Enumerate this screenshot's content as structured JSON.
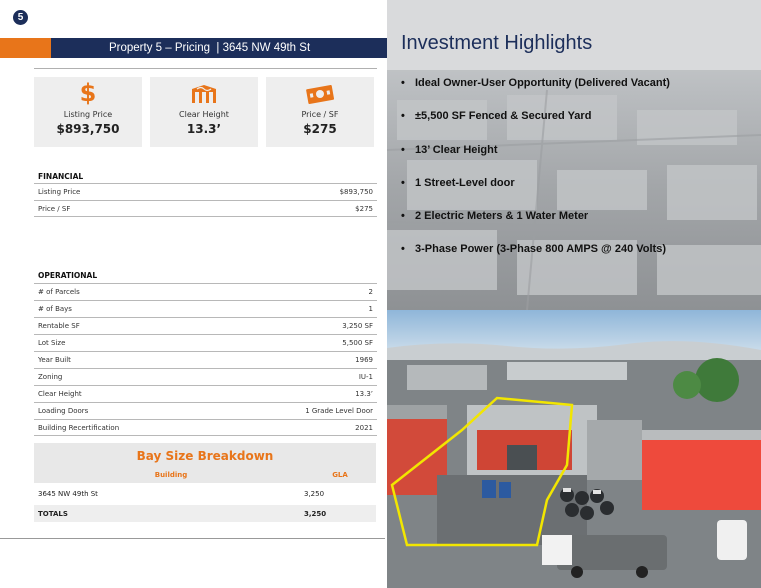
{
  "page_number": "5",
  "header": {
    "title": "Property 5 – Pricing  | 3645 NW 49th St"
  },
  "cards": [
    {
      "icon": "dollar-icon",
      "label": "Listing Price",
      "value": "$893,750"
    },
    {
      "icon": "warehouse-icon",
      "label": "Clear Height",
      "value": "13.3’"
    },
    {
      "icon": "cash-icon",
      "label": "Price / SF",
      "value": "$275"
    }
  ],
  "financial": {
    "title": "FINANCIAL",
    "rows": [
      {
        "label": "Listing Price",
        "value": "$893,750"
      },
      {
        "label": "Price / SF",
        "value": "$275"
      }
    ]
  },
  "operational": {
    "title": "OPERATIONAL",
    "rows": [
      {
        "label": "# of Parcels",
        "value": "2"
      },
      {
        "label": "# of Bays",
        "value": "1"
      },
      {
        "label": "Rentable SF",
        "value": "3,250 SF"
      },
      {
        "label": "Lot Size",
        "value": "5,500 SF"
      },
      {
        "label": "Year Built",
        "value": "1969"
      },
      {
        "label": "Zoning",
        "value": "IU-1"
      },
      {
        "label": "Clear Height",
        "value": "13.3’"
      },
      {
        "label": "Loading Doors",
        "value": "1 Grade Level Door"
      },
      {
        "label": "Building Recertification",
        "value": "2021"
      }
    ]
  },
  "bay_breakdown": {
    "title": "Bay Size Breakdown",
    "col_building": "Building",
    "col_gla": "GLA",
    "rows": [
      {
        "building": "3645 NW 49th St",
        "gla": "3,250"
      }
    ],
    "total_label": "TOTALS",
    "total_value": "3,250"
  },
  "highlights": {
    "title": "Investment Highlights",
    "bullet": "•",
    "items": [
      "Ideal Owner-User Opportunity (Delivered Vacant)",
      "±5,500 SF Fenced & Secured Yard",
      "13’ Clear Height",
      "1 Street-Level door",
      "2 Electric Meters & 1 Water Meter",
      "3-Phase Power (3-Phase 800 AMPS @ 240 Volts)"
    ]
  },
  "colors": {
    "navy": "#1c2e5a",
    "orange": "#e8751a",
    "card_bg": "#eeeeee",
    "outline_yellow": "#f2e600"
  }
}
